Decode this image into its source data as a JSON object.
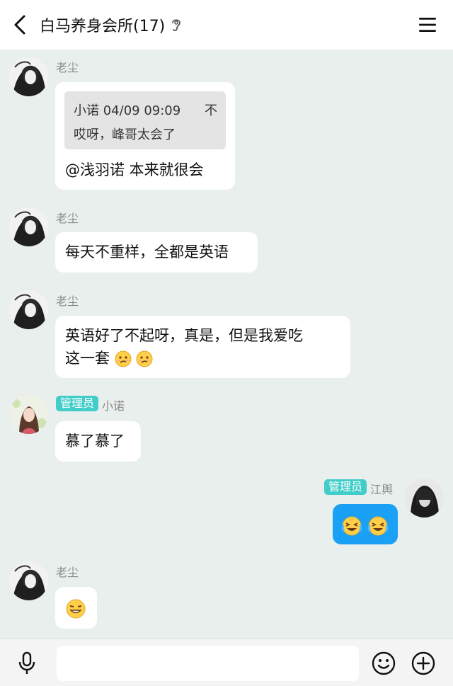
{
  "header": {
    "title": "白马养身会所(17)",
    "back_icon": "chevron-left-icon",
    "ear_icon": "earpiece-icon",
    "menu_icon": "hamburger-menu-icon"
  },
  "messages": [
    {
      "sender": "老尘",
      "quote": {
        "author_time": "小诺 04/09 09:09",
        "pin": "不",
        "text": "哎呀，峰哥太会了"
      },
      "text": "@浅羽诺 本来就很会"
    },
    {
      "sender": "老尘",
      "text": "每天不重样，全都是英语"
    },
    {
      "sender": "老尘",
      "text_line1": "英语好了不起呀，真是，但是我爱吃",
      "text_line2": "这一套",
      "emojis": [
        "thinking-face-icon",
        "thinking-face-icon"
      ]
    },
    {
      "badge": "管理员",
      "sender": "小诺",
      "text": "慕了慕了"
    },
    {
      "badge": "管理员",
      "sender": "江舆",
      "self": true,
      "emojis": [
        "laughing-tears-face-icon",
        "laughing-tears-face-icon"
      ],
      "bubble_color": "#1aa1f5"
    },
    {
      "sender": "老尘",
      "emojis": [
        "grinning-squint-face-icon"
      ]
    }
  ],
  "input": {
    "placeholder": "",
    "mic_icon": "microphone-icon",
    "emoji_icon": "smiley-icon",
    "plus_icon": "plus-circle-icon"
  },
  "colors": {
    "badge": "#43cdc9",
    "self_bubble": "#1aa1f5",
    "background": "#e9efec"
  }
}
